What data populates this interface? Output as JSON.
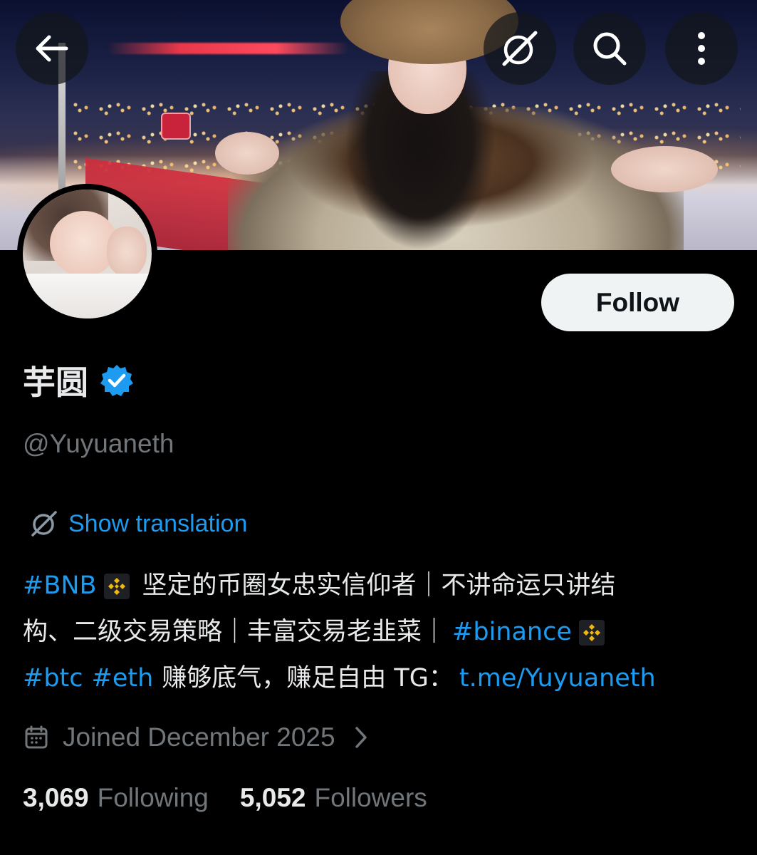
{
  "topbar": {
    "back_icon": "arrow-left-icon",
    "grok_icon": "grok-slash-circle-icon",
    "search_icon": "search-icon",
    "more_icon": "vertical-dots-icon"
  },
  "profile": {
    "display_name": "芋圆",
    "verified": true,
    "handle": "@Yuyuaneth",
    "follow_label": "Follow"
  },
  "translation": {
    "label": "Show translation"
  },
  "bio": {
    "line1": {
      "tag": "#BNB",
      "text": "坚定的币圈女忠实信仰者｜不讲命运只讲结"
    },
    "line2": {
      "text": "构、二级交易策略｜丰富交易老韭菜｜",
      "tag": "#binance"
    },
    "line3": {
      "tag_btc": "#btc",
      "tag_eth": "#eth",
      "text": "赚够底气，赚足自由 TG：",
      "link": "t.me/Yuyuaneth"
    }
  },
  "joined": {
    "text": "Joined December 2025"
  },
  "stats": {
    "following_count": "3,069",
    "following_label": "Following",
    "followers_count": "5,052",
    "followers_label": "Followers"
  },
  "colors": {
    "accent": "#1d9bf0",
    "muted": "#71767b",
    "text": "#e7e9ea",
    "background": "#000000",
    "binance_yellow": "#f0b90b"
  }
}
